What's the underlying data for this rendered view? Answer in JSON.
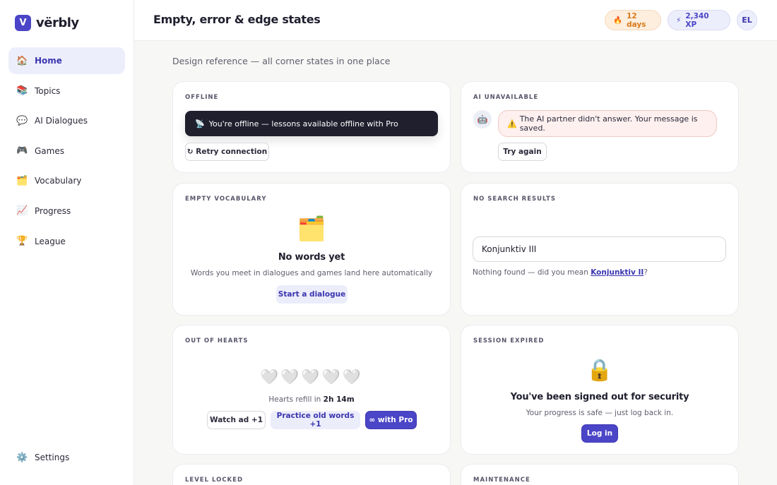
{
  "brand": {
    "mark": "V",
    "name": "vërbly",
    "accent_color": "#4b45c7"
  },
  "sidebar": {
    "items": [
      {
        "icon": "🏠",
        "icon_name": "home-icon",
        "label": "Home",
        "active": true
      },
      {
        "icon": "📚",
        "icon_name": "books-icon",
        "label": "Topics"
      },
      {
        "icon": "💬",
        "icon_name": "speech-bubble-icon",
        "label": "AI Dialogues"
      },
      {
        "icon": "🎮",
        "icon_name": "game-controller-icon",
        "label": "Games"
      },
      {
        "icon": "🗂️",
        "icon_name": "card-index-icon",
        "label": "Vocabulary"
      },
      {
        "icon": "📈",
        "icon_name": "chart-up-icon",
        "label": "Progress"
      },
      {
        "icon": "🏆",
        "icon_name": "trophy-icon",
        "label": "League"
      }
    ],
    "settings": {
      "icon": "⚙️",
      "icon_name": "gear-icon",
      "label": "Settings"
    }
  },
  "header": {
    "title": "Empty, error & edge states",
    "streak": {
      "icon": "🔥",
      "icon_name": "flame-icon",
      "label": "12 days"
    },
    "xp": {
      "icon": "⚡",
      "icon_name": "lightning-icon",
      "label": "2,340 XP"
    },
    "avatar_initials": "EL"
  },
  "subtitle": "Design reference — all corner states in one place",
  "cards": {
    "offline": {
      "label": "OFFLINE",
      "banner_icon": "📡",
      "banner_icon_name": "satellite-antenna-icon",
      "banner_text": "You're offline — lessons available offline with Pro",
      "retry_label": "↻ Retry connection"
    },
    "ai_unavailable": {
      "label": "AI UNAVAILABLE",
      "bot_icon": "🤖",
      "bot_icon_name": "robot-icon",
      "warning_icon": "⚠️",
      "warning_icon_name": "warning-icon",
      "message": "The AI partner didn't answer. Your message is saved.",
      "try_again_label": "Try again"
    },
    "empty_vocabulary": {
      "label": "EMPTY VOCABULARY",
      "icon": "🗂️",
      "icon_name": "card-index-icon",
      "title": "No words yet",
      "description": "Words you meet in dialogues and games land here automatically",
      "cta_label": "Start a dialogue"
    },
    "no_search_results": {
      "label": "NO SEARCH RESULTS",
      "search_value": "Konjunktiv III",
      "hint_prefix": "Nothing found — did you mean ",
      "hint_link": "Konjunktiv II",
      "hint_suffix": "?"
    },
    "out_of_hearts": {
      "label": "OUT OF HEARTS",
      "hearts": "🤍🤍🤍🤍🤍",
      "hearts_icon_name": "white-heart-icon",
      "hearts_remaining": 0,
      "refill_prefix": "Hearts refill in ",
      "refill_time": "2h 14m",
      "watch_ad_label": "Watch ad +1",
      "practice_label": "Practice old words +1",
      "pro_label": "∞ with Pro"
    },
    "session_expired": {
      "label": "SESSION EXPIRED",
      "icon": "🔒",
      "icon_name": "lock-icon",
      "title": "You've been signed out for security",
      "description": "Your progress is safe — just log back in.",
      "login_label": "Log in"
    },
    "level_locked": {
      "label": "LEVEL LOCKED"
    },
    "maintenance": {
      "label": "MAINTENANCE"
    }
  }
}
